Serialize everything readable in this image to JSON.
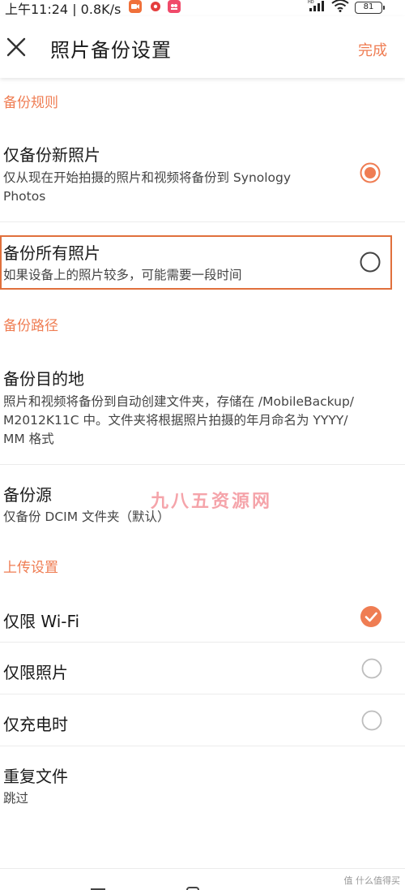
{
  "status_bar": {
    "time": "上午11:24 | 0.8K/s",
    "battery": "81"
  },
  "header": {
    "title": "照片备份设置",
    "done_label": "完成"
  },
  "sections": {
    "backup_rules": "备份规则",
    "backup_path": "备份路径",
    "upload_settings": "上传设置"
  },
  "backup_rules": {
    "new_only": {
      "title": "仅备份新照片",
      "desc_line1": "仅从现在开始拍摄的照片和视频将备份到 Synology",
      "desc_line2": "Photos",
      "selected": true
    },
    "all": {
      "title": "备份所有照片",
      "desc": "如果设备上的照片较多，可能需要一段时间",
      "selected": false
    }
  },
  "backup_path": {
    "destination": {
      "title": "备份目的地",
      "desc_line1": "照片和视频将备份到自动创建文件夹，存储在 /MobileBackup/",
      "desc_line2": "M2012K11C 中。文件夹将根据照片拍摄的年月命名为 YYYY/",
      "desc_line3": "MM 格式"
    },
    "source": {
      "title": "备份源",
      "desc": "仅备份 DCIM 文件夹（默认）"
    }
  },
  "upload_settings": {
    "wifi_only": {
      "title": "仅限 Wi-Fi",
      "checked": true
    },
    "photos_only": {
      "title": "仅限照片",
      "checked": false
    },
    "charging_only": {
      "title": "仅充电时",
      "checked": false
    },
    "duplicate": {
      "title": "重复文件",
      "value": "跳过"
    }
  },
  "watermark": "九八五资源网",
  "corner_logo": "值 什么值得买",
  "colors": {
    "accent": "#ef7d53",
    "highlight_border": "#e0703c",
    "text": "#1a1a1a"
  }
}
